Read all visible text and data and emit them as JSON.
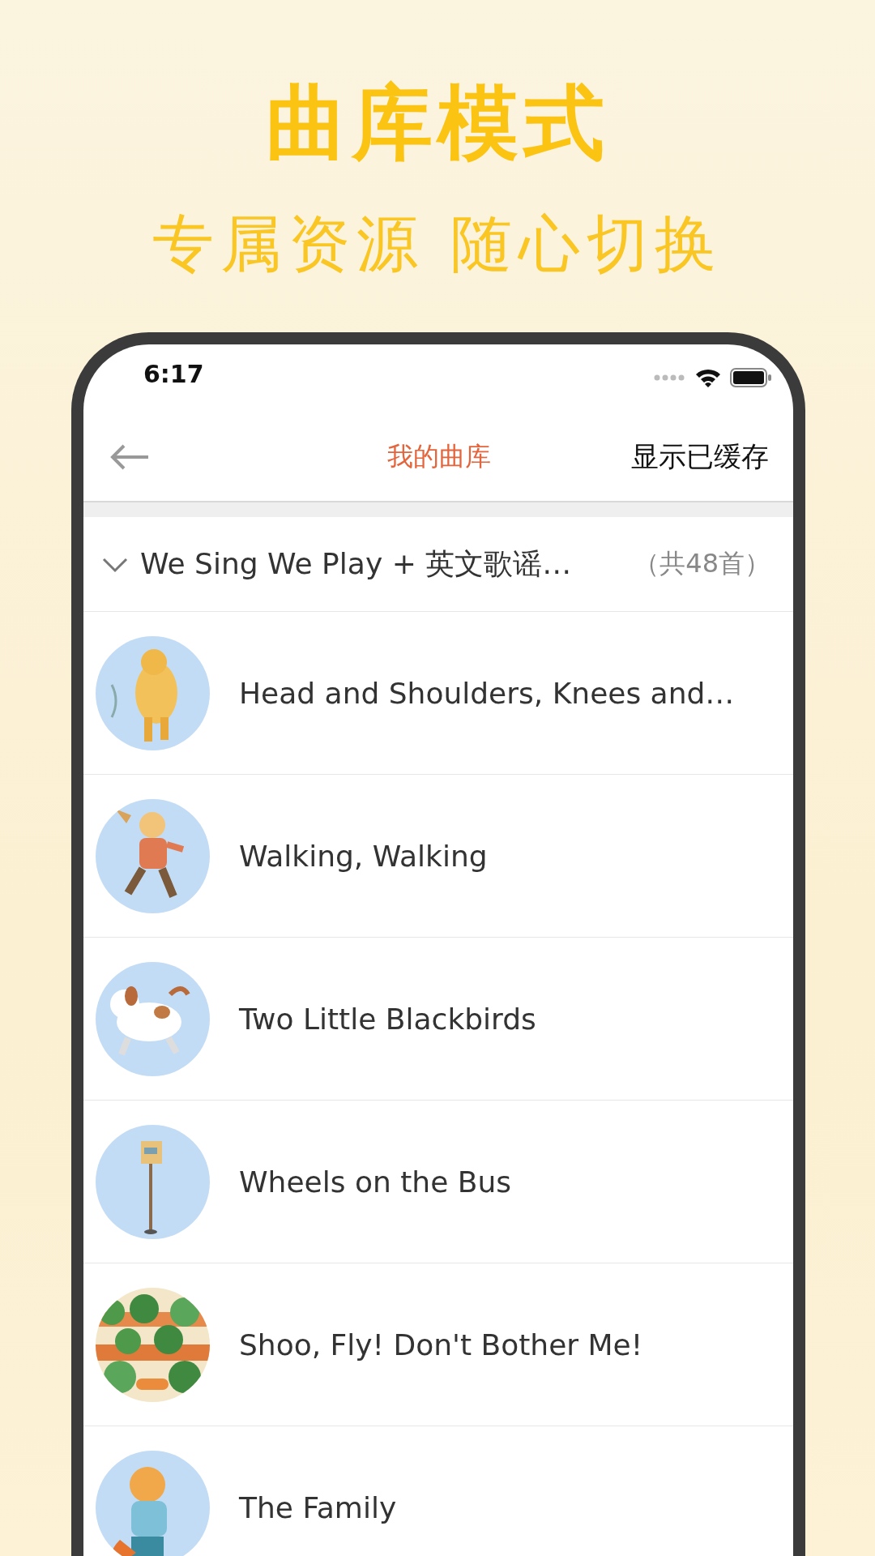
{
  "promo": {
    "title": "曲库模式",
    "subtitle": "专属资源 随心切换"
  },
  "status_bar": {
    "time": "6:17"
  },
  "nav": {
    "title": "我的曲库",
    "action": "显示已缓存"
  },
  "group": {
    "title": "We Sing We Play + 英文歌谣…",
    "count": "（共48首）",
    "expanded": true
  },
  "songs": [
    {
      "title": "Head and Shoulders, Knees and…"
    },
    {
      "title": "Walking, Walking"
    },
    {
      "title": "Two Little Blackbirds"
    },
    {
      "title": "Wheels on the Bus"
    },
    {
      "title": "Shoo, Fly! Don't Bother Me!"
    },
    {
      "title": "The Family"
    }
  ]
}
